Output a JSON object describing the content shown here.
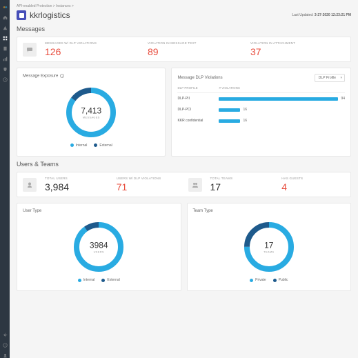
{
  "breadcrumb": "API-enabled Protection > Instances >",
  "title": "kkrlogistics",
  "last_updated_label": "Last Updated:",
  "last_updated_value": "3-27-2020 12:23:21 PM",
  "messages": {
    "section_title": "Messages",
    "metrics": [
      {
        "label": "MESSAGES W/ DLP VIOLATIONS",
        "value": "126"
      },
      {
        "label": "VIOLATION IN MESSAGE TEXT",
        "value": "89"
      },
      {
        "label": "VIOLATION IN ATTACHMENT",
        "value": "37"
      }
    ],
    "exposure": {
      "title": "Message Exposure",
      "donut_value": "7,413",
      "donut_label": "MESSAGES",
      "legend": [
        {
          "label": "Internal",
          "color": "#29abe2"
        },
        {
          "label": "External",
          "color": "#1e5a8c"
        }
      ],
      "donut_colors": [
        "#29abe2",
        "#1e5a8c"
      ],
      "donut_split": [
        85,
        15
      ]
    },
    "violations": {
      "title": "Message DLP Violations",
      "select_label": "DLP Profile",
      "columns": [
        "DLP PROFILE",
        "# VIOLATIONS"
      ],
      "rows": [
        {
          "name": "DLP-PII",
          "value": 94,
          "pct": 100
        },
        {
          "name": "DLP-PCI",
          "value": 16,
          "pct": 17
        },
        {
          "name": "KKR confidential",
          "value": 16,
          "pct": 17
        }
      ]
    }
  },
  "users": {
    "section_title": "Users & Teams",
    "metrics": [
      {
        "label": "TOTAL USERS",
        "value": "3,984",
        "red": false
      },
      {
        "label": "USERS W/ DLP VIOLATIONS",
        "value": "71",
        "red": true
      },
      {
        "label": "TOTAL TEAMS",
        "value": "17",
        "red": false
      },
      {
        "label": "HAS GUESTS",
        "value": "4",
        "red": true
      }
    ],
    "user_type": {
      "title": "User Type",
      "donut_value": "3984",
      "donut_label": "USERS",
      "legend": [
        {
          "label": "Internal",
          "color": "#29abe2"
        },
        {
          "label": "External",
          "color": "#1e5a8c"
        }
      ],
      "donut_colors": [
        "#29abe2",
        "#1e5a8c"
      ],
      "donut_split": [
        90,
        10
      ]
    },
    "team_type": {
      "title": "Team Type",
      "donut_value": "17",
      "donut_label": "TEAMS",
      "legend": [
        {
          "label": "Private",
          "color": "#29abe2"
        },
        {
          "label": "Public",
          "color": "#1e5a8c"
        }
      ],
      "donut_colors": [
        "#29abe2",
        "#1e5a8c"
      ],
      "donut_split": [
        75,
        25
      ]
    }
  },
  "chart_data": [
    {
      "type": "pie",
      "title": "Message Exposure",
      "series": [
        {
          "name": "Internal",
          "values": [
            85
          ]
        },
        {
          "name": "External",
          "values": [
            15
          ]
        }
      ],
      "total_label": "7,413 MESSAGES"
    },
    {
      "type": "bar",
      "title": "Message DLP Violations",
      "categories": [
        "DLP-PII",
        "DLP-PCI",
        "KKR confidential"
      ],
      "values": [
        94,
        16,
        16
      ],
      "xlabel": "# Violations"
    },
    {
      "type": "pie",
      "title": "User Type",
      "series": [
        {
          "name": "Internal",
          "values": [
            90
          ]
        },
        {
          "name": "External",
          "values": [
            10
          ]
        }
      ],
      "total_label": "3984 USERS"
    },
    {
      "type": "pie",
      "title": "Team Type",
      "series": [
        {
          "name": "Private",
          "values": [
            75
          ]
        },
        {
          "name": "Public",
          "values": [
            25
          ]
        }
      ],
      "total_label": "17 TEAMS"
    }
  ]
}
